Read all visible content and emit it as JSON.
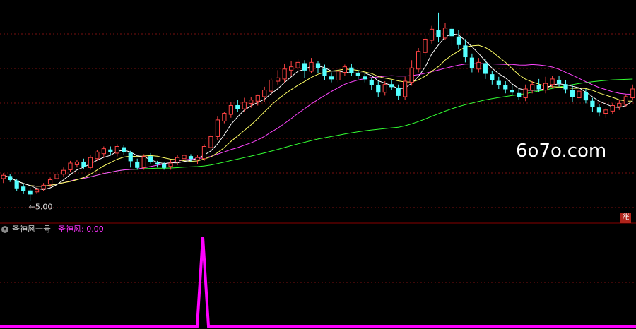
{
  "colors": {
    "background": "#000000",
    "rise": "#ff4444",
    "fall": "#54ffff",
    "ma5": "#ffffff",
    "ma10": "#ffff66",
    "ma20": "#ff44ff",
    "ma60": "#33ff33",
    "grid": "#7a1010",
    "indicator": "#ff00ff",
    "divider": "#880000"
  },
  "price_panel": {
    "low_marker": "←5.00",
    "watermark": "6o7o.com"
  },
  "badge": {
    "label": "涨"
  },
  "indicator_panel": {
    "name": "圣神风一号",
    "series_label": "圣神风:",
    "series_value": "0.00"
  },
  "chart_data": {
    "type": "candlestick",
    "candles": [
      [
        120,
        126,
        112,
        130
      ],
      [
        124,
        118,
        114,
        128
      ],
      [
        116,
        103,
        98,
        120
      ],
      [
        105,
        98,
        92,
        110
      ],
      [
        98,
        92,
        80,
        104
      ],
      [
        96,
        100,
        92,
        104
      ],
      [
        102,
        108,
        98,
        112
      ],
      [
        110,
        118,
        105,
        122
      ],
      [
        120,
        128,
        116,
        132
      ],
      [
        128,
        135,
        124,
        140
      ],
      [
        136,
        148,
        132,
        152
      ],
      [
        145,
        150,
        140,
        154
      ],
      [
        150,
        142,
        138,
        156
      ],
      [
        140,
        158,
        136,
        162
      ],
      [
        156,
        168,
        152,
        172
      ],
      [
        165,
        174,
        158,
        178
      ],
      [
        172,
        168,
        162,
        178
      ],
      [
        166,
        178,
        160,
        182
      ],
      [
        176,
        168,
        162,
        180
      ],
      [
        166,
        152,
        140,
        170
      ],
      [
        150,
        140,
        136,
        156
      ],
      [
        140,
        160,
        136,
        164
      ],
      [
        160,
        150,
        146,
        166
      ],
      [
        148,
        146,
        140,
        152
      ],
      [
        146,
        140,
        136,
        150
      ],
      [
        142,
        148,
        136,
        154
      ],
      [
        150,
        158,
        144,
        162
      ],
      [
        156,
        162,
        148,
        168
      ],
      [
        160,
        156,
        150,
        164
      ],
      [
        154,
        158,
        146,
        162
      ],
      [
        156,
        178,
        152,
        182
      ],
      [
        176,
        196,
        172,
        200
      ],
      [
        196,
        226,
        190,
        232
      ],
      [
        224,
        238,
        220,
        240
      ],
      [
        236,
        252,
        230,
        258
      ],
      [
        252,
        246,
        240,
        262
      ],
      [
        246,
        258,
        240,
        266
      ],
      [
        256,
        262,
        248,
        268
      ],
      [
        260,
        270,
        252,
        272
      ],
      [
        268,
        280,
        258,
        286
      ],
      [
        278,
        298,
        270,
        302
      ],
      [
        296,
        302,
        290,
        316
      ],
      [
        300,
        318,
        294,
        328
      ],
      [
        316,
        322,
        306,
        332
      ],
      [
        320,
        330,
        314,
        336
      ],
      [
        328,
        316,
        302,
        334
      ],
      [
        314,
        330,
        310,
        338
      ],
      [
        328,
        320,
        310,
        332
      ],
      [
        318,
        306,
        298,
        326
      ],
      [
        304,
        300,
        294,
        312
      ],
      [
        298,
        314,
        294,
        320
      ],
      [
        312,
        322,
        306,
        326
      ],
      [
        320,
        312,
        306,
        328
      ],
      [
        310,
        306,
        300,
        316
      ],
      [
        304,
        300,
        294,
        310
      ],
      [
        298,
        290,
        280,
        302
      ],
      [
        288,
        276,
        268,
        296
      ],
      [
        276,
        290,
        270,
        296
      ],
      [
        290,
        286,
        280,
        298
      ],
      [
        284,
        270,
        262,
        290
      ],
      [
        268,
        296,
        262,
        304
      ],
      [
        294,
        320,
        288,
        334
      ],
      [
        318,
        350,
        312,
        356
      ],
      [
        348,
        372,
        340,
        380
      ],
      [
        370,
        390,
        364,
        396
      ],
      [
        388,
        376,
        366,
        420
      ],
      [
        374,
        392,
        370,
        402
      ],
      [
        390,
        378,
        360,
        398
      ],
      [
        376,
        362,
        354,
        388
      ],
      [
        360,
        340,
        330,
        372
      ],
      [
        338,
        320,
        312,
        346
      ],
      [
        318,
        330,
        312,
        338
      ],
      [
        328,
        310,
        300,
        336
      ],
      [
        308,
        298,
        290,
        314
      ],
      [
        296,
        290,
        282,
        304
      ],
      [
        288,
        282,
        274,
        296
      ],
      [
        280,
        276,
        270,
        288
      ],
      [
        274,
        268,
        262,
        282
      ],
      [
        266,
        282,
        260,
        290
      ],
      [
        280,
        290,
        274,
        296
      ],
      [
        288,
        282,
        276,
        300
      ],
      [
        280,
        292,
        274,
        304
      ],
      [
        290,
        300,
        284,
        306
      ],
      [
        298,
        292,
        286,
        306
      ],
      [
        290,
        282,
        274,
        298
      ],
      [
        280,
        268,
        258,
        290
      ],
      [
        266,
        278,
        260,
        284
      ],
      [
        276,
        262,
        256,
        282
      ],
      [
        260,
        250,
        240,
        266
      ],
      [
        248,
        240,
        232,
        254
      ],
      [
        238,
        244,
        230,
        248
      ],
      [
        242,
        252,
        236,
        256
      ],
      [
        250,
        256,
        244,
        262
      ],
      [
        254,
        268,
        250,
        272
      ],
      [
        266,
        282,
        262,
        290
      ]
    ]
  }
}
